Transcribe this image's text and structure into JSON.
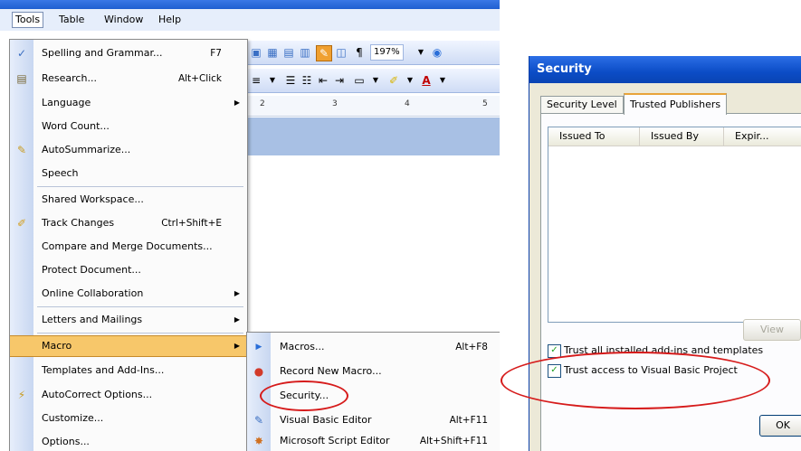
{
  "word": {
    "menubar": [
      "Tools",
      "Table",
      "Window",
      "Help"
    ],
    "toolbar": {
      "zoom": "197%"
    },
    "ruler": [
      "2",
      "3",
      "4",
      "5"
    ]
  },
  "tools_menu": {
    "items": [
      {
        "label": "Spelling and Grammar...",
        "shortcut": "F7",
        "icon": "spelling-icon"
      },
      {
        "label": "Research...",
        "shortcut": "Alt+Click",
        "icon": "research-icon"
      },
      {
        "label": "Language",
        "submenu": true
      },
      {
        "label": "Word Count..."
      },
      {
        "label": "AutoSummarize...",
        "icon": "autosummarize-icon"
      },
      {
        "label": "Speech"
      },
      {
        "label": "Shared Workspace..."
      },
      {
        "label": "Track Changes",
        "shortcut": "Ctrl+Shift+E",
        "icon": "track-changes-icon"
      },
      {
        "label": "Compare and Merge Documents..."
      },
      {
        "label": "Protect Document..."
      },
      {
        "label": "Online Collaboration",
        "submenu": true
      },
      {
        "label": "Letters and Mailings",
        "submenu": true
      },
      {
        "label": "Macro",
        "submenu": true,
        "selected": true
      },
      {
        "label": "Templates and Add-Ins..."
      },
      {
        "label": "AutoCorrect Options...",
        "icon": "autocorrect-icon"
      },
      {
        "label": "Customize..."
      },
      {
        "label": "Options..."
      }
    ]
  },
  "macro_submenu": {
    "items": [
      {
        "label": "Macros...",
        "shortcut": "Alt+F8",
        "icon": "play-icon"
      },
      {
        "label": "Record New Macro...",
        "icon": "record-icon"
      },
      {
        "label": "Security..."
      },
      {
        "label": "Visual Basic Editor",
        "shortcut": "Alt+F11",
        "icon": "vb-editor-icon"
      },
      {
        "label": "Microsoft Script Editor",
        "shortcut": "Alt+Shift+F11",
        "icon": "script-editor-icon"
      }
    ]
  },
  "security_dialog": {
    "title": "Security",
    "tabs": [
      "Security Level",
      "Trusted Publishers"
    ],
    "columns": [
      "Issued To",
      "Issued By",
      "Expir..."
    ],
    "view_button": "View",
    "checkbox1": {
      "label": "Trust all installed add-ins and templates",
      "checked": true
    },
    "checkbox2": {
      "label": "Trust access to Visual Basic Project",
      "checked": true
    },
    "ok_button": "OK"
  },
  "colors": {
    "annotation": "#d61b1b",
    "menu_highlight": "#f7c76a",
    "title_blue": "#0b4cc6"
  }
}
